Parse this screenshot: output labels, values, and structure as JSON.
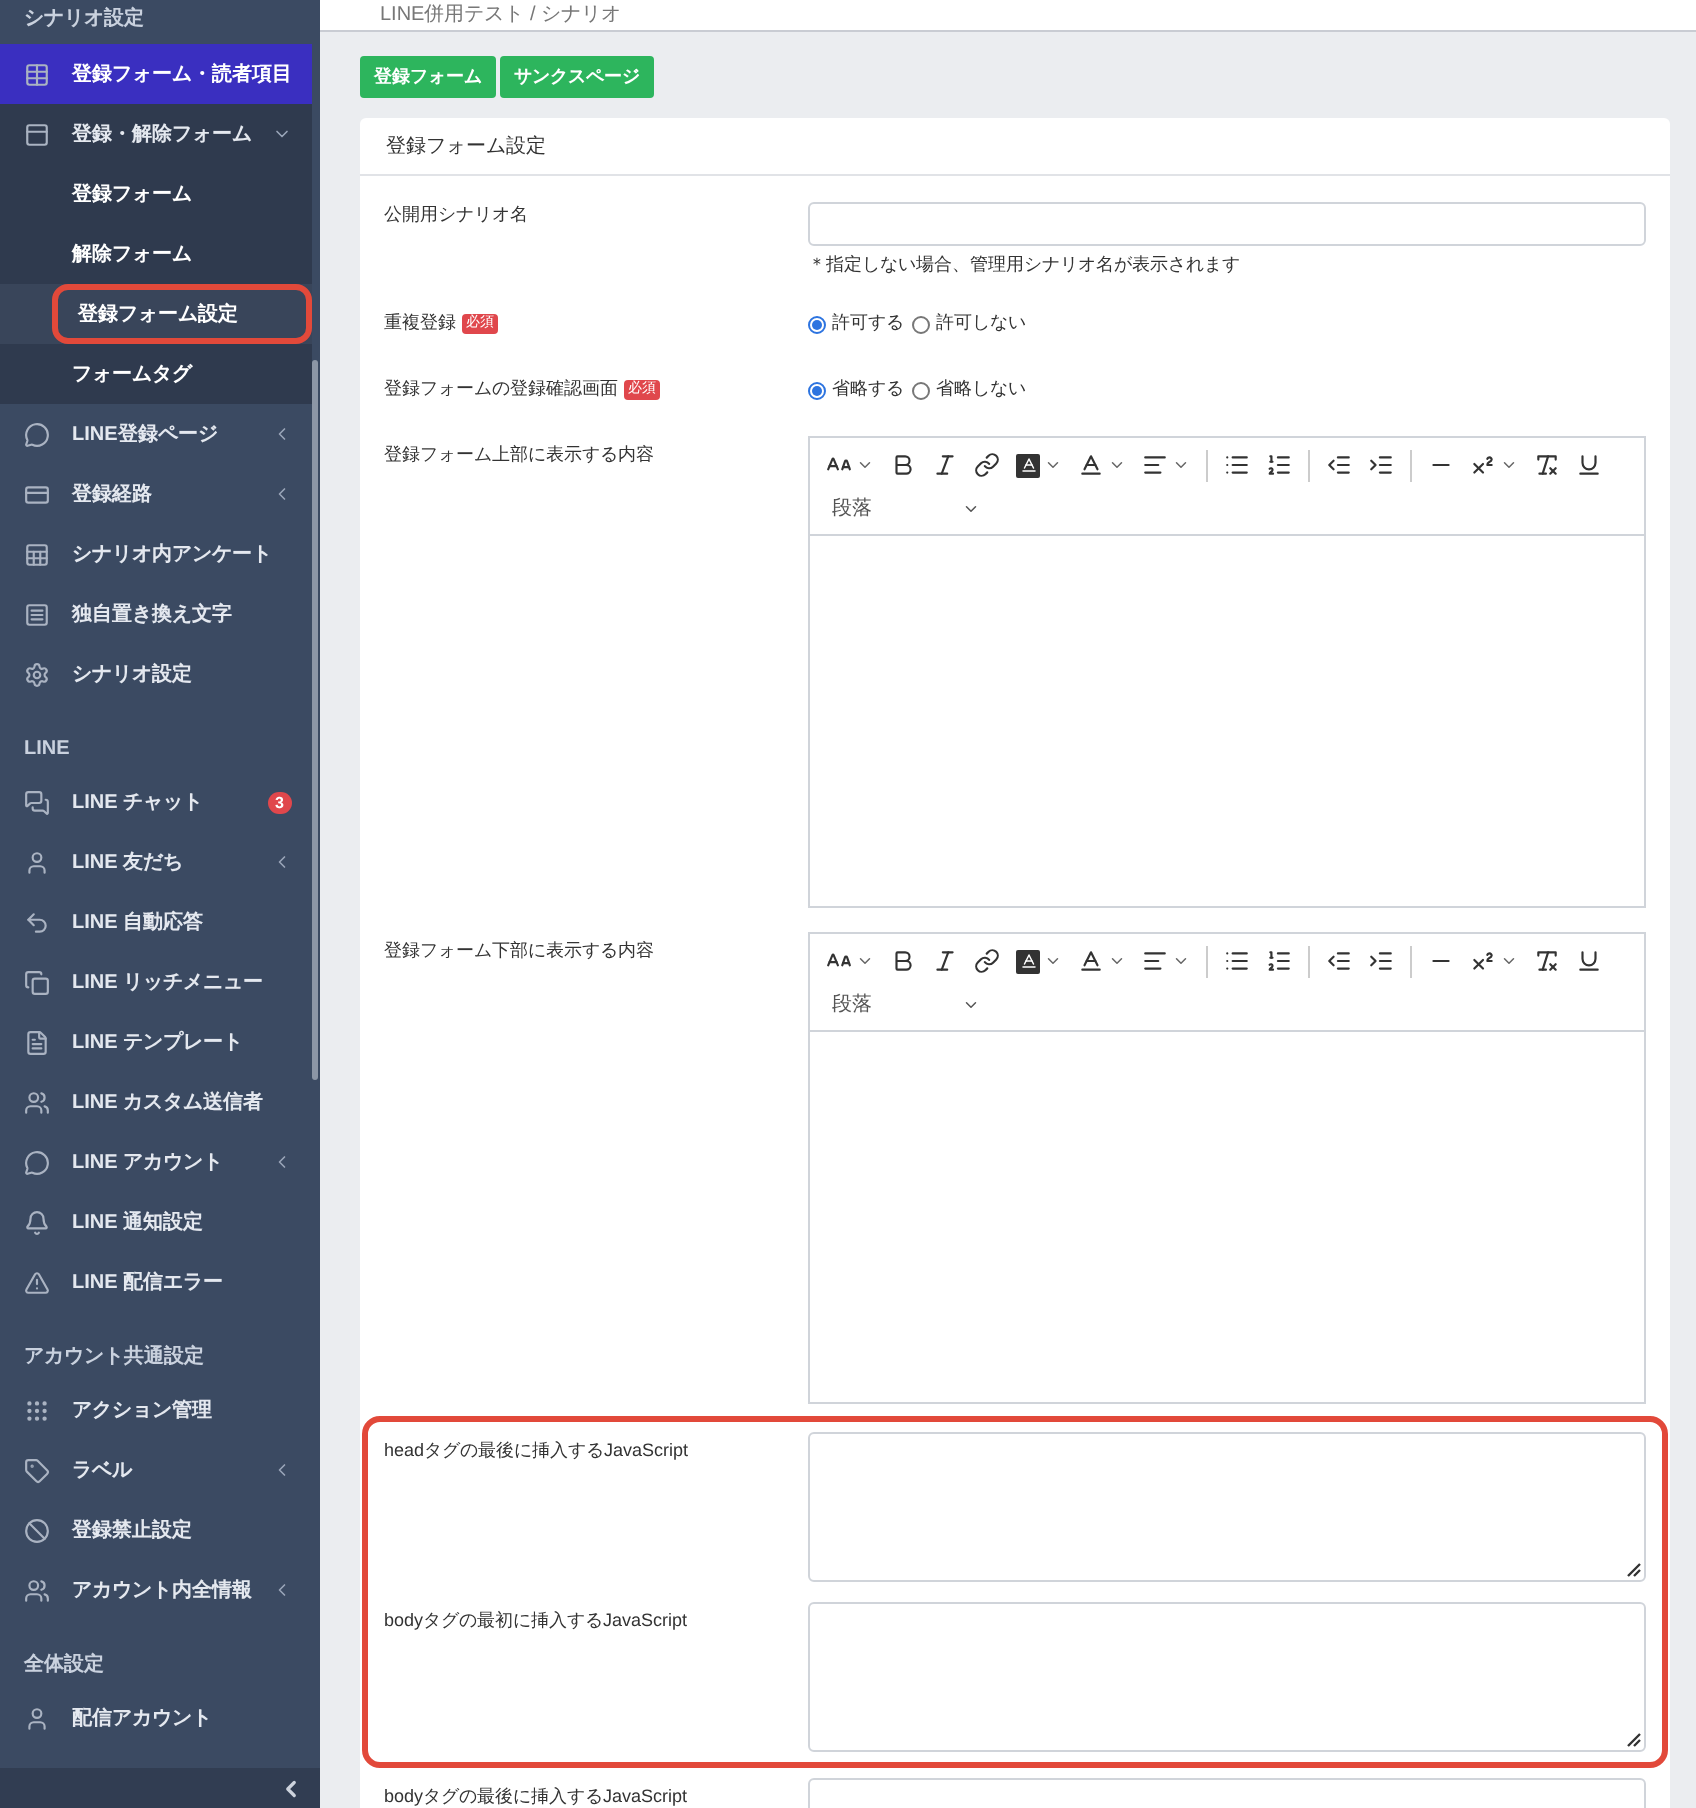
{
  "sidebar": {
    "sections": [
      {
        "label": "シナリオ設定",
        "items": [
          {
            "label": "登録フォーム・読者項目",
            "selected": true
          },
          {
            "label": "登録・解除フォーム",
            "selected": false,
            "expanded": true,
            "children": [
              {
                "label": "登録フォーム",
                "selected": false,
                "highlighted": false
              },
              {
                "label": "解除フォーム",
                "selected": false,
                "highlighted": false
              },
              {
                "label": "登録フォーム設定",
                "selected": true,
                "highlighted": true
              },
              {
                "label": "フォームタグ",
                "selected": false,
                "highlighted": false
              }
            ]
          },
          {
            "label": "LINE登録ページ",
            "selected": false,
            "expanded": false
          },
          {
            "label": "登録経路",
            "selected": false,
            "expanded": false
          },
          {
            "label": "シナリオ内アンケート",
            "selected": false
          },
          {
            "label": "独自置き換え文字",
            "selected": false
          },
          {
            "label": "シナリオ設定",
            "selected": false
          }
        ]
      },
      {
        "label": "LINE",
        "items": [
          {
            "label": "LINE チャット",
            "selected": false,
            "badge": "3"
          },
          {
            "label": "LINE 友だち",
            "selected": false,
            "expanded": false
          },
          {
            "label": "LINE 自動応答",
            "selected": false
          },
          {
            "label": "LINE リッチメニュー",
            "selected": false
          },
          {
            "label": "LINE テンプレート",
            "selected": false
          },
          {
            "label": "LINE カスタム送信者",
            "selected": false
          },
          {
            "label": "LINE アカウント",
            "selected": false,
            "expanded": false
          },
          {
            "label": "LINE 通知設定",
            "selected": false
          },
          {
            "label": "LINE 配信エラー",
            "selected": false
          }
        ]
      },
      {
        "label": "アカウント共通設定",
        "items": [
          {
            "label": "アクション管理",
            "selected": false
          },
          {
            "label": "ラベル",
            "selected": false,
            "expanded": false
          },
          {
            "label": "登録禁止設定",
            "selected": false
          },
          {
            "label": "アカウント内全情報",
            "selected": false,
            "expanded": false
          }
        ]
      },
      {
        "label": "全体設定",
        "items": [
          {
            "label": "配信アカウント",
            "selected": false
          }
        ]
      }
    ]
  },
  "breadcrumb": "LINE併用テスト / シナリオ",
  "tab_buttons": [
    "登録フォーム",
    "サンクスページ"
  ],
  "card": {
    "title": "登録フォーム設定",
    "groups": [
      {
        "highlighted": false,
        "rows": [
          {
            "kind": "text",
            "label": "公開用シナリオ名",
            "hint": "＊指定しない場合、管理用シナリオ名が表示されます"
          },
          {
            "kind": "radio",
            "label": "重複登録",
            "required": "必須",
            "options": [
              {
                "label": "許可する",
                "selected": true
              },
              {
                "label": "許可しない",
                "selected": false
              }
            ]
          },
          {
            "kind": "radio",
            "label": "登録フォームの登録確認画面",
            "required": "必須",
            "options": [
              {
                "label": "省略する",
                "selected": true
              },
              {
                "label": "省略しない",
                "selected": false
              }
            ]
          },
          {
            "kind": "editor",
            "label": "登録フォーム上部に表示する内容",
            "format": "段落"
          },
          {
            "kind": "editor",
            "label": "登録フォーム下部に表示する内容",
            "format": "段落"
          }
        ]
      },
      {
        "highlighted": true,
        "rows": [
          {
            "kind": "textarea",
            "label": "headタグの最後に挿入するJavaScript"
          },
          {
            "kind": "textarea",
            "label": "bodyタグの最初に挿入するJavaScript"
          }
        ]
      },
      {
        "highlighted": false,
        "rows": [
          {
            "kind": "textarea",
            "label": "bodyタグの最後に挿入するJavaScript"
          }
        ]
      }
    ]
  }
}
